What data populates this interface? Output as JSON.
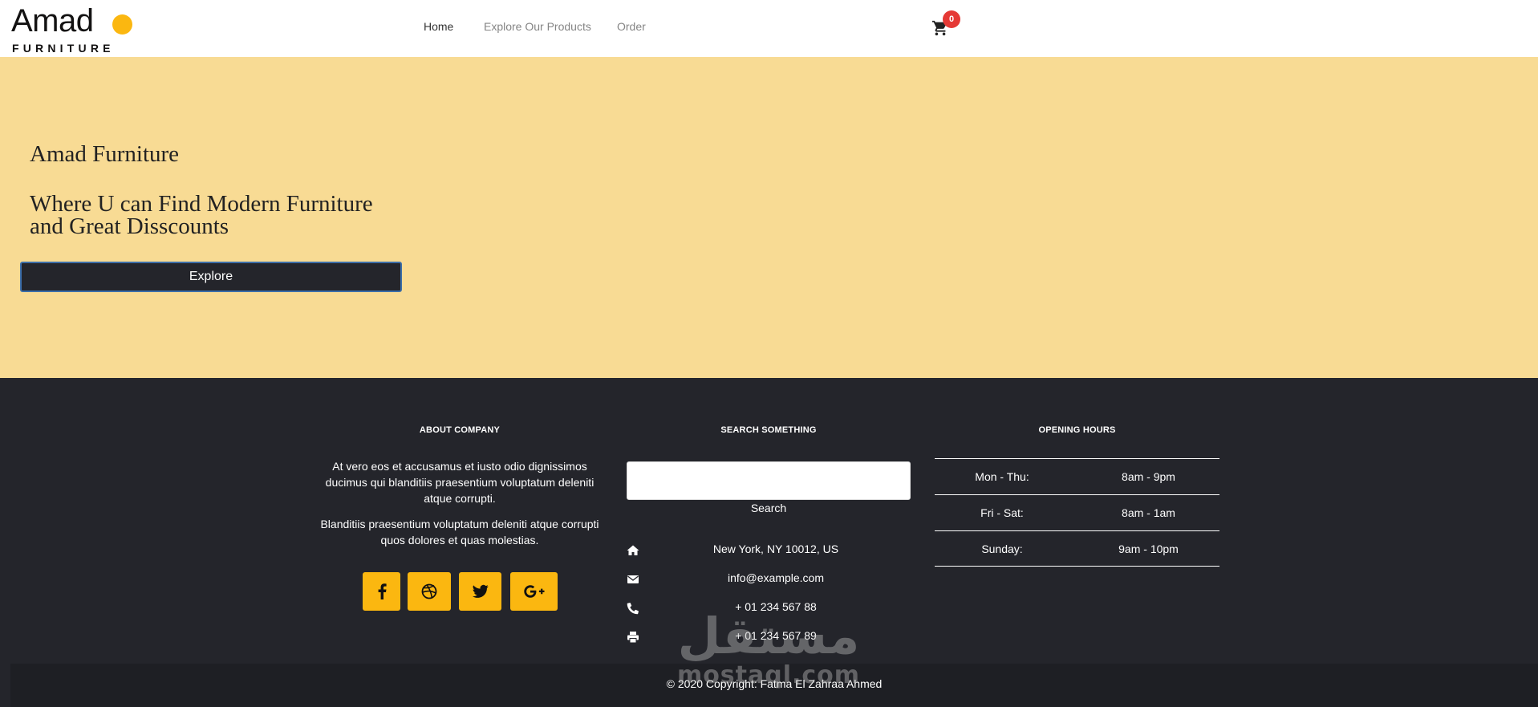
{
  "header": {
    "logo": {
      "word": "Amad",
      "subtitle": "FURNITURE",
      "dot_color": "#fbb710"
    },
    "nav": [
      {
        "label": "Home",
        "active": true
      },
      {
        "label": "Explore Our Products",
        "active": false
      },
      {
        "label": "Order",
        "active": false
      }
    ],
    "cart": {
      "icon": "shopping-cart-icon",
      "count": "0"
    }
  },
  "hero": {
    "title": "Amad Furniture",
    "tagline": "Where U can Find Modern Furniture and Great Disscounts",
    "explore_label": "Explore",
    "background": "#f8db94"
  },
  "footer": {
    "background": "#24252b",
    "about": {
      "title": "ABOUT COMPANY",
      "paragraphs": [
        "At vero eos et accusamus et iusto odio dignissimos ducimus qui blanditiis praesentium voluptatum deleniti atque corrupti.",
        "Blanditiis praesentium voluptatum deleniti atque corrupti quos dolores et quas molestias."
      ],
      "social": [
        {
          "icon": "facebook-icon"
        },
        {
          "icon": "dribbble-icon"
        },
        {
          "icon": "twitter-icon"
        },
        {
          "icon": "google-plus-icon"
        }
      ]
    },
    "search": {
      "title": "SEARCH SOMETHING",
      "placeholder": "",
      "button_label": "Search"
    },
    "contact": [
      {
        "icon": "home-icon",
        "text": "New York, NY 10012, US"
      },
      {
        "icon": "envelope-icon",
        "text": "info@example.com"
      },
      {
        "icon": "phone-icon",
        "text": "+ 01 234 567 88"
      },
      {
        "icon": "print-icon",
        "text": "+ 01 234 567 89"
      }
    ],
    "hours": {
      "title": "OPENING HOURS",
      "rows": [
        {
          "day": "Mon - Thu:",
          "time": "8am - 9pm"
        },
        {
          "day": "Fri - Sat:",
          "time": "8am - 1am"
        },
        {
          "day": "Sunday:",
          "time": "9am - 10pm"
        }
      ]
    },
    "copyright": "© 2020 Copyright: Fatma El Zahraa Ahmed"
  },
  "watermark": {
    "arabic": "مستقل",
    "latin": "mostaql.com"
  }
}
